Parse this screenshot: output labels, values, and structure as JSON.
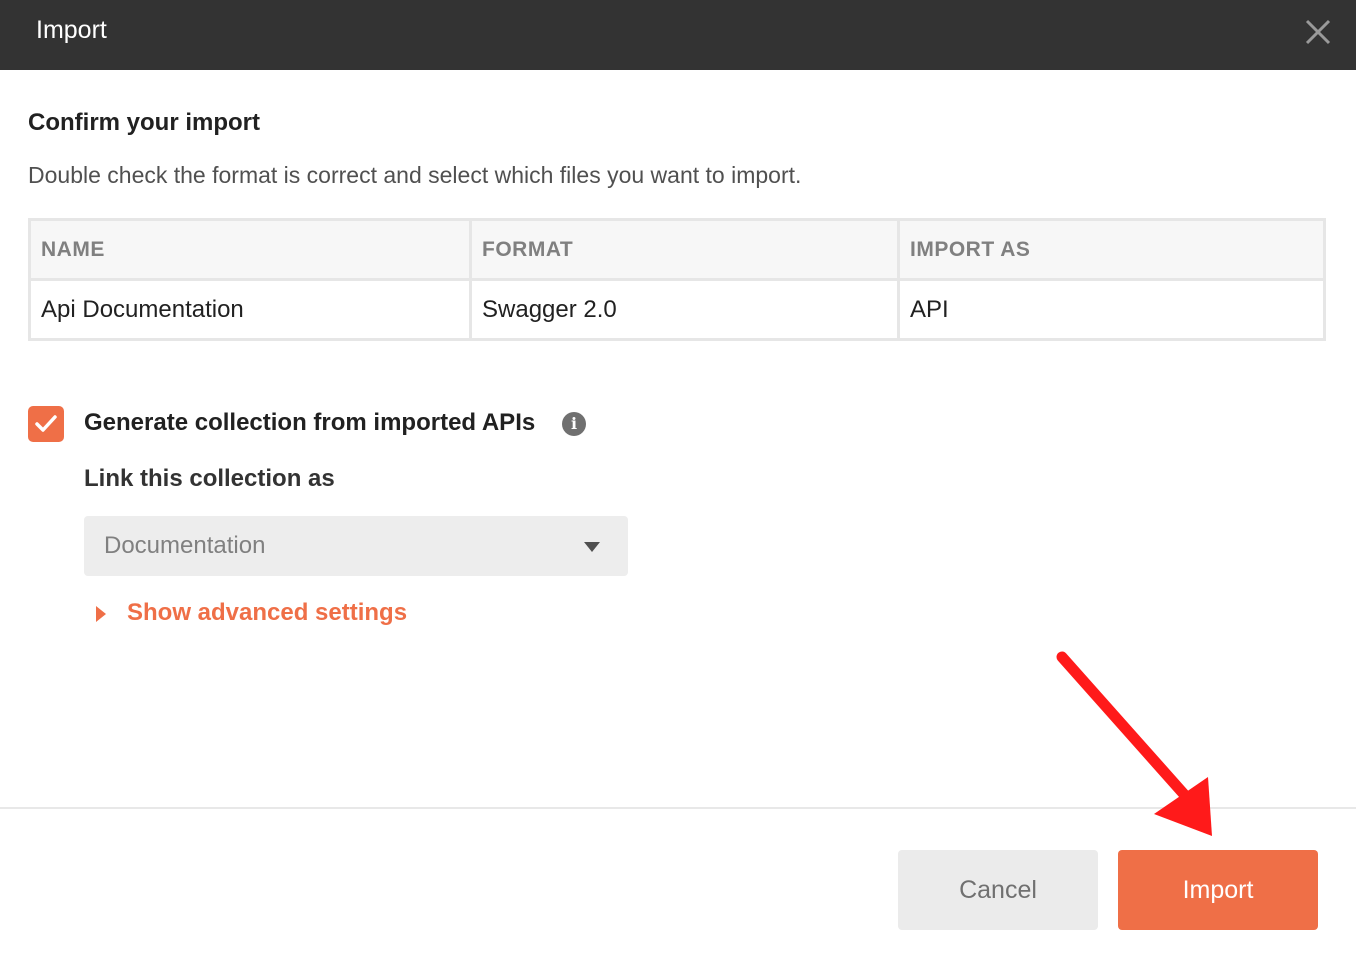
{
  "header": {
    "title": "Import"
  },
  "confirm": {
    "title": "Confirm your import",
    "description": "Double check the format is correct and select which files you want to import."
  },
  "table": {
    "columns": [
      "NAME",
      "FORMAT",
      "IMPORT AS"
    ],
    "rows": [
      {
        "name": "Api Documentation",
        "format": "Swagger 2.0",
        "import_as": "API"
      }
    ]
  },
  "generate_collection": {
    "checked": true,
    "label": "Generate collection from imported APIs",
    "info_glyph": "i"
  },
  "link_collection": {
    "label": "Link this collection as",
    "selected": "Documentation"
  },
  "advanced": {
    "label": "Show advanced settings"
  },
  "footer": {
    "cancel_label": "Cancel",
    "import_label": "Import"
  },
  "colors": {
    "accent": "#ef6f47",
    "header_bg": "#333333",
    "annotation_arrow": "#ff1a1a"
  },
  "icons": {
    "close": "close-icon",
    "checkbox": "checkmark-icon",
    "info": "info-icon",
    "dropdown": "chevron-down-icon",
    "expand": "caret-right-icon",
    "annotation": "annotation-arrow-icon"
  }
}
